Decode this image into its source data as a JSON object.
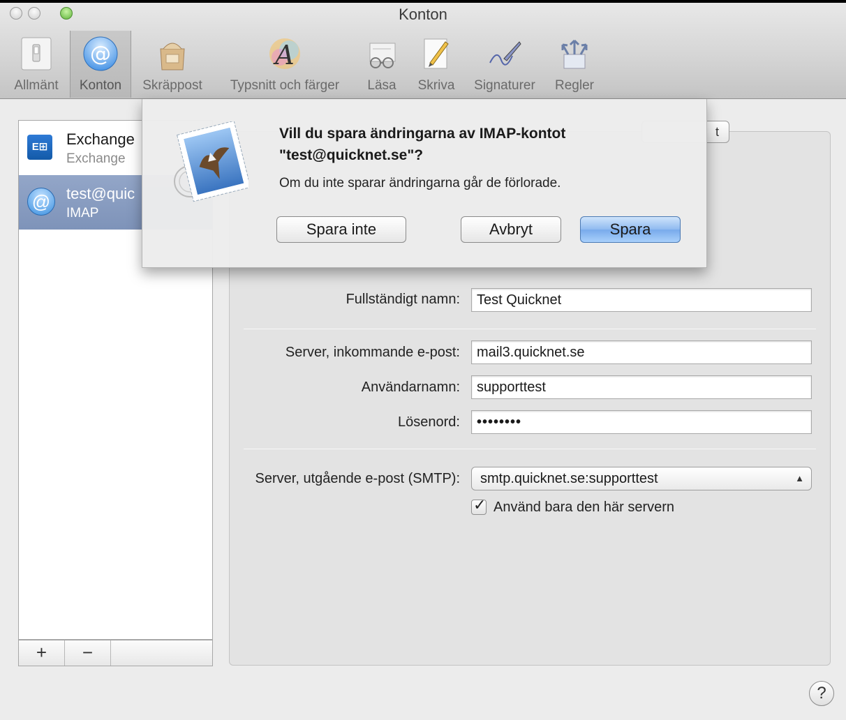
{
  "window": {
    "title": "Konton"
  },
  "toolbar": {
    "items": [
      {
        "label": "Allmänt",
        "icon": "switch-icon"
      },
      {
        "label": "Konton",
        "icon": "at-sign-icon"
      },
      {
        "label": "Skräppost",
        "icon": "junk-bag-icon"
      },
      {
        "label": "Typsnitt och färger",
        "icon": "font-color-icon"
      },
      {
        "label": "Läsa",
        "icon": "glasses-icon"
      },
      {
        "label": "Skriva",
        "icon": "pencil-icon"
      },
      {
        "label": "Signaturer",
        "icon": "signature-pen-icon"
      },
      {
        "label": "Regler",
        "icon": "rules-arrows-icon"
      }
    ],
    "active": "Konton"
  },
  "accounts": [
    {
      "name": "Exchange",
      "type": "Exchange",
      "icon": "exchange-icon",
      "selected": false
    },
    {
      "name": "test@quic",
      "type": "IMAP",
      "icon": "at-sign-icon",
      "selected": true
    }
  ],
  "list_buttons": {
    "add": "+",
    "remove": "−"
  },
  "details": {
    "tab_partial": "t",
    "fields": {
      "full_name_label": "Fullständigt namn:",
      "full_name_value": "Test Quicknet",
      "incoming_server_label": "Server, inkommande e-post:",
      "incoming_server_value": "mail3.quicknet.se",
      "username_label": "Användarnamn:",
      "username_value": "supporttest",
      "password_label": "Lösenord:",
      "password_value": "••••••••",
      "smtp_label": "Server, utgående e-post (SMTP):",
      "smtp_value": "smtp.quicknet.se:supporttest",
      "only_this_server_label": "Använd bara den här servern",
      "only_this_server_checked": true
    }
  },
  "sheet": {
    "title": "Vill du spara ändringarna av IMAP-kontot \"test@quicknet.se\"?",
    "message": "Om du inte sparar ändringarna går de förlorade.",
    "dont_save": "Spara inte",
    "cancel": "Avbryt",
    "save": "Spara",
    "icon": "mail-stamp-eagle-icon"
  },
  "help": {
    "label": "?"
  }
}
